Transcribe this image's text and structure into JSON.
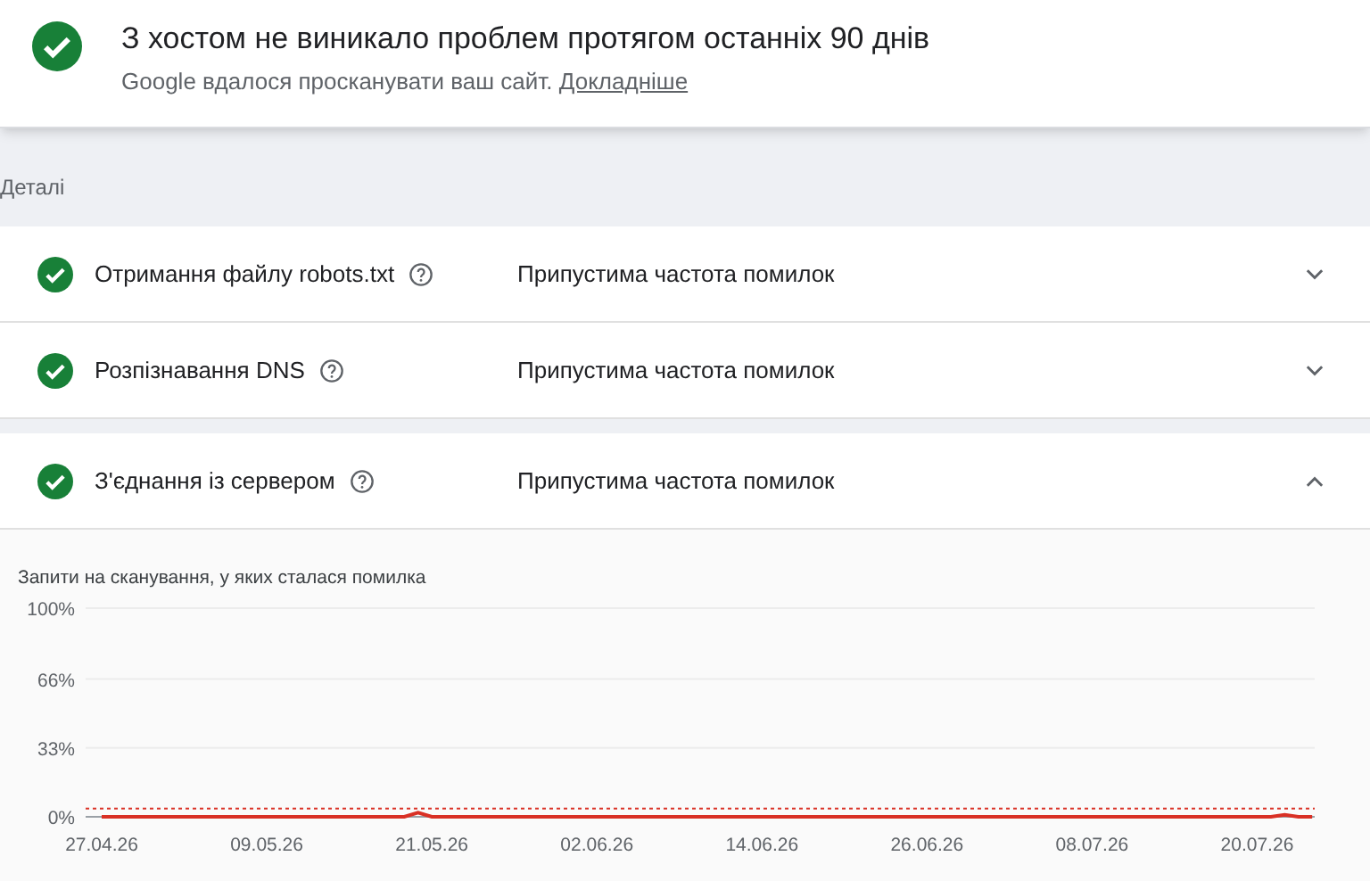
{
  "summary": {
    "title": "З хостом не виникало проблем протягом останніх 90 днів",
    "subtitle": "Google вдалося просканувати ваш сайт.",
    "link": "Докладніше"
  },
  "details_label": "Деталі",
  "checks": [
    {
      "name": "Отримання файлу robots.txt",
      "status": "Припустима частота помилок",
      "expanded": false
    },
    {
      "name": "Розпізнавання DNS",
      "status": "Припустима частота помилок",
      "expanded": false
    },
    {
      "name": "З'єднання із сервером",
      "status": "Припустима частота помилок",
      "expanded": true
    }
  ],
  "chart_data": {
    "type": "line",
    "title": "Запити на сканування, у яких сталася помилка",
    "ylim": [
      0,
      100
    ],
    "categories": [
      "27.04.26",
      null,
      null,
      null,
      null,
      null,
      null,
      null,
      null,
      null,
      null,
      null,
      "09.05.26",
      null,
      null,
      null,
      null,
      null,
      null,
      null,
      null,
      null,
      null,
      null,
      "21.05.26",
      null,
      null,
      null,
      null,
      null,
      null,
      null,
      null,
      null,
      null,
      null,
      "02.06.26",
      null,
      null,
      null,
      null,
      null,
      null,
      null,
      null,
      null,
      null,
      null,
      "14.06.26",
      null,
      null,
      null,
      null,
      null,
      null,
      null,
      null,
      null,
      null,
      null,
      "26.06.26",
      null,
      null,
      null,
      null,
      null,
      null,
      null,
      null,
      null,
      null,
      null,
      "08.07.26",
      null,
      null,
      null,
      null,
      null,
      null,
      null,
      null,
      null,
      null,
      null,
      "20.07.26",
      null,
      null,
      null,
      null
    ],
    "series": [
      {
        "color": "#d93025",
        "values": [
          0,
          0,
          0,
          0,
          0,
          0,
          0,
          0,
          0,
          0,
          0,
          0,
          0,
          0,
          0,
          0,
          0,
          0,
          0,
          0,
          0,
          0,
          0,
          2,
          0,
          0,
          0,
          0,
          0,
          0,
          0,
          0,
          0,
          0,
          0,
          0,
          0,
          0,
          0,
          0,
          0,
          0,
          0,
          0,
          0,
          0,
          0,
          0,
          0,
          0,
          0,
          0,
          0,
          0,
          0,
          0,
          0,
          0,
          0,
          0,
          0,
          0,
          0,
          0,
          0,
          0,
          0,
          0,
          0,
          0,
          0,
          0,
          0,
          0,
          0,
          0,
          0,
          0,
          0,
          0,
          0,
          0,
          0,
          0,
          0,
          0,
          1,
          0,
          0
        ]
      }
    ],
    "yticks": [
      {
        "value": 0,
        "label": "0%"
      },
      {
        "value": 33,
        "label": "33%"
      },
      {
        "value": 66,
        "label": "66%"
      },
      {
        "value": 100,
        "label": "100%"
      }
    ],
    "ref_lines": [
      {
        "axis": "y",
        "value": 4,
        "color": "#d93025"
      }
    ]
  }
}
